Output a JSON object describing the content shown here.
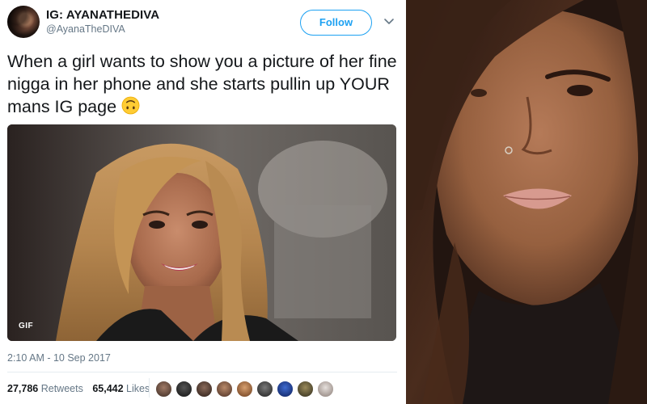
{
  "tweet": {
    "display_name": "IG: AYANATHEDIVA",
    "handle": "@AyanaTheDIVA",
    "follow_label": "Follow",
    "text": "When a girl wants to show you a picture of her fine nigga in her phone and she starts pullin up YOUR mans IG page",
    "text_emoji": "upside-down-face-icon",
    "media": {
      "badge": "GIF",
      "kind": "animated-gif"
    },
    "timestamp": "2:10 AM - 10 Sep 2017",
    "stats": {
      "retweets_count": "27,786",
      "retweets_label": "Retweets",
      "likes_count": "65,442",
      "likes_label": "Likes"
    },
    "likers_shown": 9
  },
  "photo": {
    "kind": "selfie-photo"
  },
  "colors": {
    "accent": "#1da1f2",
    "text_primary": "#14171a",
    "text_secondary": "#657786",
    "divider": "#e6ecf0"
  }
}
